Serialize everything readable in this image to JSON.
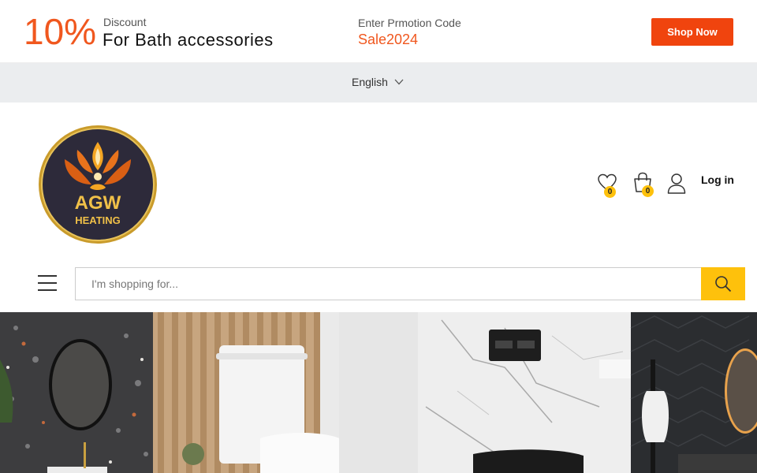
{
  "promo": {
    "percent": "10%",
    "discount_label": "Discount",
    "title": "For Bath accessories",
    "code_label": "Enter Prmotion Code",
    "code": "Sale2024",
    "button_label": "Shop Now"
  },
  "language": {
    "selected": "English"
  },
  "header": {
    "logo_text": "AGW",
    "logo_subtext": "HEATING",
    "wishlist_count": "0",
    "cart_count": "0",
    "login_label": "Log in"
  },
  "search": {
    "placeholder": "I'm shopping for..."
  },
  "colors": {
    "accent": "#f0571e",
    "button": "#f0440e",
    "badge": "#fec10c",
    "search_button": "#fec10c"
  }
}
